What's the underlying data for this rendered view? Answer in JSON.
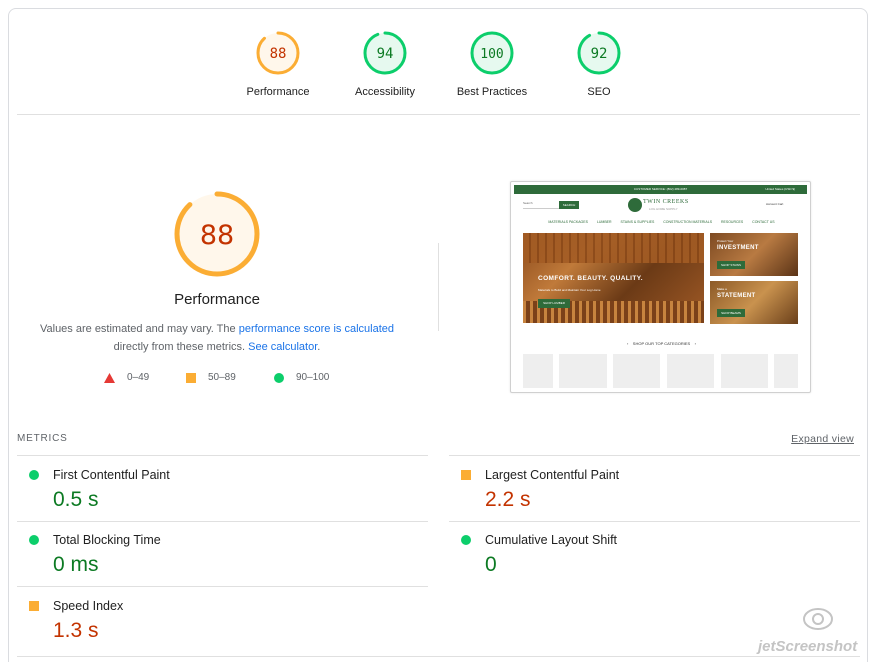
{
  "summary_gauges": [
    {
      "label": "Performance",
      "score": "88",
      "status": "average"
    },
    {
      "label": "Accessibility",
      "score": "94",
      "status": "pass"
    },
    {
      "label": "Best Practices",
      "score": "100",
      "status": "pass"
    },
    {
      "label": "SEO",
      "score": "92",
      "status": "pass"
    }
  ],
  "performance": {
    "score": "88",
    "title": "Performance",
    "desc_prefix": "Values are estimated and may vary. The ",
    "desc_link1": "performance score is calculated",
    "desc_middle": " directly from these metrics. ",
    "desc_link2": "See calculator",
    "desc_suffix": "."
  },
  "legend": [
    {
      "shape": "triangle",
      "range": "0–49",
      "color": "#e53935"
    },
    {
      "shape": "square",
      "range": "50–89",
      "color": "#fbad34"
    },
    {
      "shape": "circle",
      "range": "90–100",
      "color": "#0cce6b"
    }
  ],
  "thumbnail": {
    "topbar": "CUSTOMER SERVICE: (802) 289-0087",
    "topbar_right": "United States (USD $)",
    "search": "Search",
    "search_btn": "SEARCH",
    "logo": "TWIN CREEKS",
    "logo_sub": "LOG HOME SUPPLY",
    "account": "Account   Cart",
    "nav": [
      "MATERIALS PACKAGES",
      "LUMBER",
      "STAINS & SUPPLIES",
      "CONSTRUCTION MATERIALS",
      "RESOURCES",
      "CONTACT US"
    ],
    "hero_title": "COMFORT. BEAUTY. QUALITY.",
    "hero_sub": "Materials to Build and Maintain Your Log Home",
    "hero_btn": "SHOP LUMBER",
    "side1_small": "Protect Your",
    "side1_title": "INVESTMENT",
    "side1_btn": "SHOP STAINS",
    "side2_small": "Make a",
    "side2_title": "STATEMENT",
    "side2_btn": "SHOP BEAMS",
    "categories": "SHOP OUR TOP CATEGORIES"
  },
  "metrics": {
    "header": "METRICS",
    "expand": "Expand view",
    "items": [
      {
        "name": "First Contentful Paint",
        "value": "0.5 s",
        "status": "pass"
      },
      {
        "name": "Largest Contentful Paint",
        "value": "2.2 s",
        "status": "average"
      },
      {
        "name": "Total Blocking Time",
        "value": "0 ms",
        "status": "pass"
      },
      {
        "name": "Cumulative Layout Shift",
        "value": "0",
        "status": "pass"
      },
      {
        "name": "Speed Index",
        "value": "1.3 s",
        "status": "average"
      }
    ]
  },
  "watermark": "jetScreenshot",
  "colors": {
    "pass": "#0cce6b",
    "pass_text": "#0c7a23",
    "average": "#fbad34",
    "average_text": "#c33300",
    "pass_bg": "#e6f9ef",
    "average_bg": "#fff7eb"
  }
}
